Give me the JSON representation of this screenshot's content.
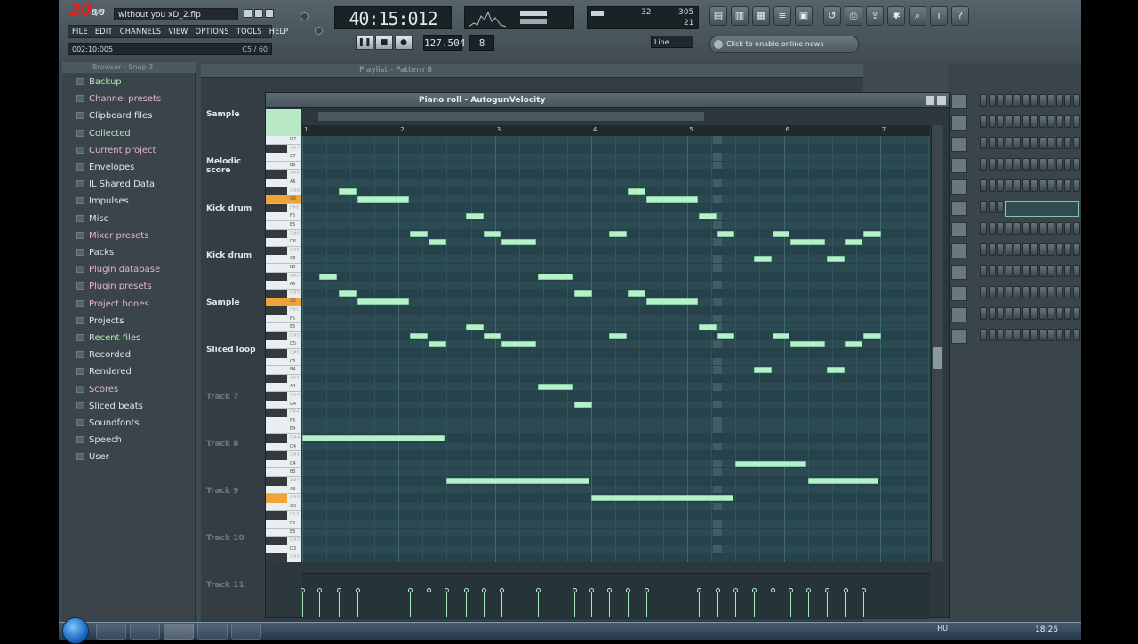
{
  "app": {
    "file_title": "without you xD_2.flp",
    "menu": [
      "FILE",
      "EDIT",
      "CHANNELS",
      "VIEW",
      "OPTIONS",
      "TOOLS",
      "HELP"
    ],
    "song_position": "002:10:005",
    "song_position_right": "C5 / 60",
    "time_display": "40:15:012",
    "cpu_left": "32",
    "cpu_right": "305",
    "cpu_sub": "21",
    "tempo": "127.504",
    "pattern_num": "8",
    "snap_mode": "Line",
    "news_text": "Click to enable online news"
  },
  "browser": {
    "title": "Browser - Snap 3",
    "items": [
      {
        "label": "Backup",
        "style": "green"
      },
      {
        "label": "Channel presets",
        "style": "pink"
      },
      {
        "label": "Clipboard files",
        "style": "white"
      },
      {
        "label": "Collected",
        "style": "green"
      },
      {
        "label": "Current project",
        "style": "pink"
      },
      {
        "label": "Envelopes",
        "style": "white"
      },
      {
        "label": "IL Shared Data",
        "style": "white"
      },
      {
        "label": "Impulses",
        "style": "white"
      },
      {
        "label": "Misc",
        "style": "white"
      },
      {
        "label": "Mixer presets",
        "style": "pink"
      },
      {
        "label": "Packs",
        "style": "white"
      },
      {
        "label": "Plugin database",
        "style": "pink"
      },
      {
        "label": "Plugin presets",
        "style": "pink"
      },
      {
        "label": "Project bones",
        "style": "pink"
      },
      {
        "label": "Projects",
        "style": "white"
      },
      {
        "label": "Recent files",
        "style": "green"
      },
      {
        "label": "Recorded",
        "style": "white"
      },
      {
        "label": "Rendered",
        "style": "white"
      },
      {
        "label": "Scores",
        "style": "pink"
      },
      {
        "label": "Sliced beats",
        "style": "white"
      },
      {
        "label": "Soundfonts",
        "style": "white"
      },
      {
        "label": "Speech",
        "style": "white"
      },
      {
        "label": "User",
        "style": "white"
      }
    ]
  },
  "playlist": {
    "title": "Playlist - Pattern 8",
    "tracks": [
      {
        "label": "Sample",
        "dim": false
      },
      {
        "label": "Melodic score",
        "dim": false
      },
      {
        "label": "Kick drum",
        "dim": false
      },
      {
        "label": "Kick drum",
        "dim": false
      },
      {
        "label": "Sample",
        "dim": false
      },
      {
        "label": "Sliced loop",
        "dim": false
      },
      {
        "label": "Track 7",
        "dim": true
      },
      {
        "label": "Track 8",
        "dim": true
      },
      {
        "label": "Track 9",
        "dim": true
      },
      {
        "label": "Track 10",
        "dim": true
      },
      {
        "label": "Track 11",
        "dim": true
      }
    ]
  },
  "piano_roll": {
    "title": "Piano roll - Autogun",
    "target": "Velocity",
    "ruler": [
      "1",
      "2",
      "3",
      "4",
      "5",
      "6",
      "7"
    ],
    "key_labels": [
      "D7",
      "C#7",
      "C7",
      "B6",
      "A#6",
      "A6",
      "G#6",
      "G6",
      "F#6",
      "F6",
      "E6",
      "D#6",
      "D6",
      "C#6",
      "C6",
      "B5",
      "A#5",
      "A5",
      "G#5",
      "G5",
      "F#5",
      "F5",
      "E5",
      "D#5",
      "D5",
      "C#5",
      "C5",
      "B4",
      "A#4",
      "A4",
      "G#4",
      "G4",
      "F#4",
      "F4",
      "E4",
      "D#4",
      "D4",
      "C#4",
      "C4",
      "B3",
      "A#3",
      "A3",
      "G#3",
      "G3",
      "F#3",
      "F3",
      "E3",
      "D#3",
      "D3",
      "C#3"
    ],
    "notes": [
      {
        "key": "G#6",
        "start": 1.38,
        "len": 0.2
      },
      {
        "key": "G6",
        "start": 1.57,
        "len": 0.56
      },
      {
        "key": "F6",
        "start": 2.7,
        "len": 0.2
      },
      {
        "key": "D#6",
        "start": 2.12,
        "len": 0.2
      },
      {
        "key": "D6",
        "start": 2.31,
        "len": 0.2
      },
      {
        "key": "D#6",
        "start": 2.88,
        "len": 0.2
      },
      {
        "key": "D6",
        "start": 3.07,
        "len": 0.38
      },
      {
        "key": "A#5",
        "start": 1.18,
        "len": 0.2
      },
      {
        "key": "A#5",
        "start": 3.45,
        "len": 0.38
      },
      {
        "key": "G#5",
        "start": 1.38,
        "len": 0.2
      },
      {
        "key": "G5",
        "start": 1.57,
        "len": 0.56
      },
      {
        "key": "G#5",
        "start": 3.83,
        "len": 0.2
      },
      {
        "key": "E5",
        "start": 2.7,
        "len": 0.2
      },
      {
        "key": "D#5",
        "start": 2.12,
        "len": 0.2
      },
      {
        "key": "D5",
        "start": 2.31,
        "len": 0.2
      },
      {
        "key": "D#5",
        "start": 2.88,
        "len": 0.2
      },
      {
        "key": "D5",
        "start": 3.07,
        "len": 0.38
      },
      {
        "key": "A4",
        "start": 3.45,
        "len": 0.38
      },
      {
        "key": "G4",
        "start": 3.83,
        "len": 0.2
      },
      {
        "key": "G#6",
        "start": 4.38,
        "len": 0.2
      },
      {
        "key": "G6",
        "start": 4.57,
        "len": 0.56
      },
      {
        "key": "F6",
        "start": 5.12,
        "len": 0.2
      },
      {
        "key": "D#6",
        "start": 4.19,
        "len": 0.2
      },
      {
        "key": "D#6",
        "start": 5.31,
        "len": 0.2
      },
      {
        "key": "C6",
        "start": 5.69,
        "len": 0.2
      },
      {
        "key": "D#6",
        "start": 5.88,
        "len": 0.2
      },
      {
        "key": "D6",
        "start": 6.07,
        "len": 0.38
      },
      {
        "key": "C6",
        "start": 6.45,
        "len": 0.2
      },
      {
        "key": "D6",
        "start": 6.64,
        "len": 0.2
      },
      {
        "key": "D#6",
        "start": 6.83,
        "len": 0.2
      },
      {
        "key": "G#5",
        "start": 4.38,
        "len": 0.2
      },
      {
        "key": "G5",
        "start": 4.57,
        "len": 0.56
      },
      {
        "key": "E5",
        "start": 5.12,
        "len": 0.2
      },
      {
        "key": "D#5",
        "start": 4.19,
        "len": 0.2
      },
      {
        "key": "D#5",
        "start": 5.31,
        "len": 0.2
      },
      {
        "key": "B4",
        "start": 5.69,
        "len": 0.2
      },
      {
        "key": "D#5",
        "start": 5.88,
        "len": 0.2
      },
      {
        "key": "D5",
        "start": 6.07,
        "len": 0.38
      },
      {
        "key": "B4",
        "start": 6.45,
        "len": 0.2
      },
      {
        "key": "D5",
        "start": 6.64,
        "len": 0.2
      },
      {
        "key": "D#5",
        "start": 6.83,
        "len": 0.2
      },
      {
        "key": "D#4",
        "start": 1.0,
        "len": 1.5
      },
      {
        "key": "A#3",
        "start": 2.5,
        "len": 1.5
      },
      {
        "key": "G#3",
        "start": 4.0,
        "len": 1.5
      },
      {
        "key": "C4",
        "start": 5.5,
        "len": 0.75
      },
      {
        "key": "A#3",
        "start": 6.25,
        "len": 0.75
      }
    ],
    "velocities": [
      0.7,
      0.7,
      0.7,
      0.7,
      0.7,
      0.7,
      0.7,
      0.7,
      0.7,
      0.7,
      0.7,
      0.7,
      0.7,
      0.7,
      0.7,
      0.7,
      0.7,
      0.7,
      0.7,
      0.7
    ]
  },
  "taskbar": {
    "lang": "HU",
    "clock": "18:26"
  }
}
